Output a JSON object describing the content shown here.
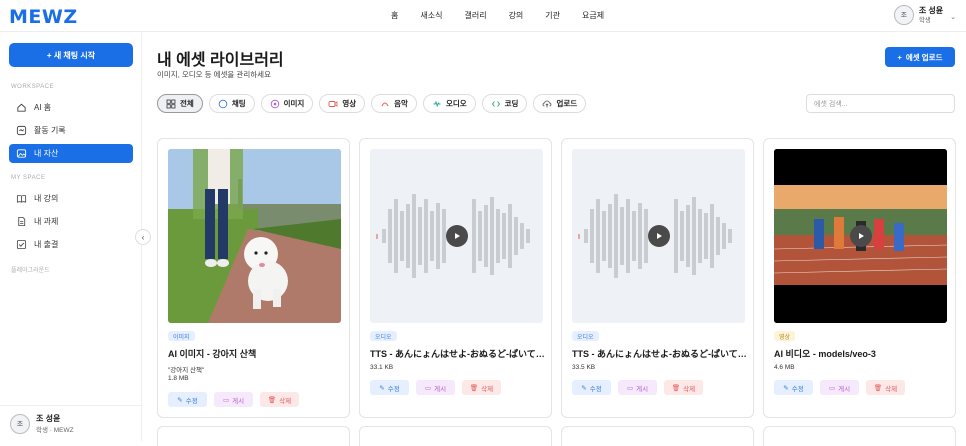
{
  "app": {
    "logo": "MEWZ"
  },
  "topnav": [
    "홈",
    "새소식",
    "갤러리",
    "강의",
    "기관",
    "요금제"
  ],
  "user": {
    "initial": "조",
    "name": "조 성윤",
    "role": "학생",
    "role_org": "학생 · MEWZ"
  },
  "sidebar": {
    "new_chat": "+ 새 채팅 시작",
    "workspace_header": "WORKSPACE",
    "workspace_items": [
      "AI 홈",
      "활동 기록",
      "내 자산"
    ],
    "myspace_header": "MY SPACE",
    "myspace_items": [
      "내 강의",
      "내 과제",
      "내 출결"
    ],
    "upgrade": "플레이그라운드"
  },
  "page": {
    "title": "내 에셋 라이브러리",
    "subtitle": "이미지, 오디오 등 에셋을 관리하세요",
    "upload": "에셋 업로드",
    "search_placeholder": "에셋 검색..."
  },
  "filters": [
    "전체",
    "채팅",
    "이미지",
    "영상",
    "음악",
    "오디오",
    "코딩",
    "업로드"
  ],
  "cards": [
    {
      "badge": "이미지",
      "title": "AI 이미지 - 강아지 산책",
      "desc": "\"강아지 산책\"",
      "size": "1.8 MB"
    },
    {
      "badge": "오디오",
      "title": "TTS - あんにょんはせよ-おぬるど-ぱいてぃん",
      "desc": "",
      "size": "33.1 KB"
    },
    {
      "badge": "오디오",
      "title": "TTS - あんにょんはせよ-おぬるど-ぱいてぃん",
      "desc": "",
      "size": "33.5 KB"
    },
    {
      "badge": "영상",
      "title": "AI 비디오 - models/veo-3",
      "desc": "",
      "size": "4.6 MB"
    }
  ],
  "actions": {
    "edit": "수정",
    "post": "게시",
    "delete": "삭제"
  },
  "colors": {
    "accent": "#1a6fe6",
    "image_badge": "#e5efff",
    "audio_badge": "#e5efff",
    "video_badge": "#fdf3d8"
  },
  "icons": [
    "grid-icon",
    "chat-icon",
    "image-icon",
    "video-icon",
    "music-icon",
    "audio-icon",
    "code-icon",
    "upload-icon",
    "home-icon",
    "history-icon",
    "asset-icon",
    "book-icon",
    "task-icon",
    "check-icon",
    "play-icon",
    "edit-icon",
    "share-icon",
    "trash-icon"
  ]
}
